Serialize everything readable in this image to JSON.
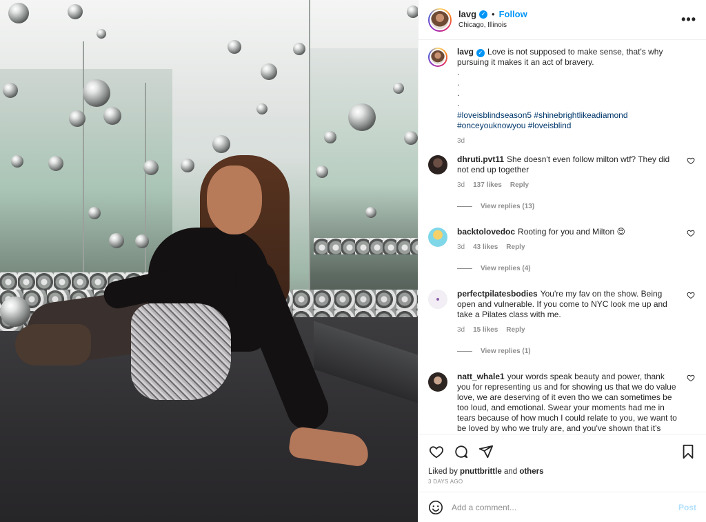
{
  "post": {
    "username": "lavg",
    "follow_label": "Follow",
    "separator": "•",
    "location": "Chicago, Illinois",
    "more_label": "•••"
  },
  "caption": {
    "username": "lavg",
    "text": "Love is not supposed to make sense, that's why pursuing it makes it an act of bravery.",
    "dots": [
      ".",
      ".",
      ".",
      "."
    ],
    "hashtags": [
      "#loveisblindseason5",
      "#shinebrightlikeadiamond",
      "#onceyouknowyou",
      "#loveisblind"
    ],
    "age": "3d"
  },
  "comments": [
    {
      "username": "dhruti.pvt11",
      "text": "She doesn't even follow milton wtf? They did not end up together",
      "age": "3d",
      "likes": "137 likes",
      "reply_label": "Reply",
      "view_replies": "View replies (13)",
      "avatar_color": "#3b2a28"
    },
    {
      "username": "backtolovedoc",
      "text": "Rooting for you and Milton 😍",
      "age": "3d",
      "likes": "43 likes",
      "reply_label": "Reply",
      "view_replies": "View replies (4)",
      "avatar_color": "#6fd3e6"
    },
    {
      "username": "perfectpilatesbodies",
      "text": "You're my fav on the show. Being open and vulnerable. If you come to NYC look me up and take a Pilates class with me.",
      "age": "3d",
      "likes": "15 likes",
      "reply_label": "Reply",
      "view_replies": "View replies (1)",
      "avatar_color": "#f3eef6"
    },
    {
      "username": "natt_whale1",
      "text": "your words speak beauty and power, thank you for representing us and for showing us that we do value love, we are deserving of it even tho we can sometimes be too loud, and emotional. Swear your moments had me in tears because of how much I could relate to you, we want to be loved by who we truly are, and you've shown that it's possible 🤍 muchas",
      "avatar_color": "#2d2522"
    }
  ],
  "footer": {
    "liked_by_prefix": "Liked by",
    "liked_by_user": "pnuttbrittle",
    "liked_by_and": "and",
    "liked_by_others": "others",
    "time": "3 DAYS AGO",
    "comment_placeholder": "Add a comment...",
    "post_label": "Post"
  },
  "icons": {
    "verified": "verified-badge-icon",
    "like": "heart-icon",
    "comment": "comment-bubble-icon",
    "share": "paper-plane-icon",
    "save": "bookmark-icon",
    "emoji": "smiley-icon",
    "more": "more-options-icon"
  },
  "colors": {
    "accent": "#0095f6",
    "link": "#00376b",
    "muted": "#8e8e8e",
    "post_disabled": "#b2dffc"
  }
}
